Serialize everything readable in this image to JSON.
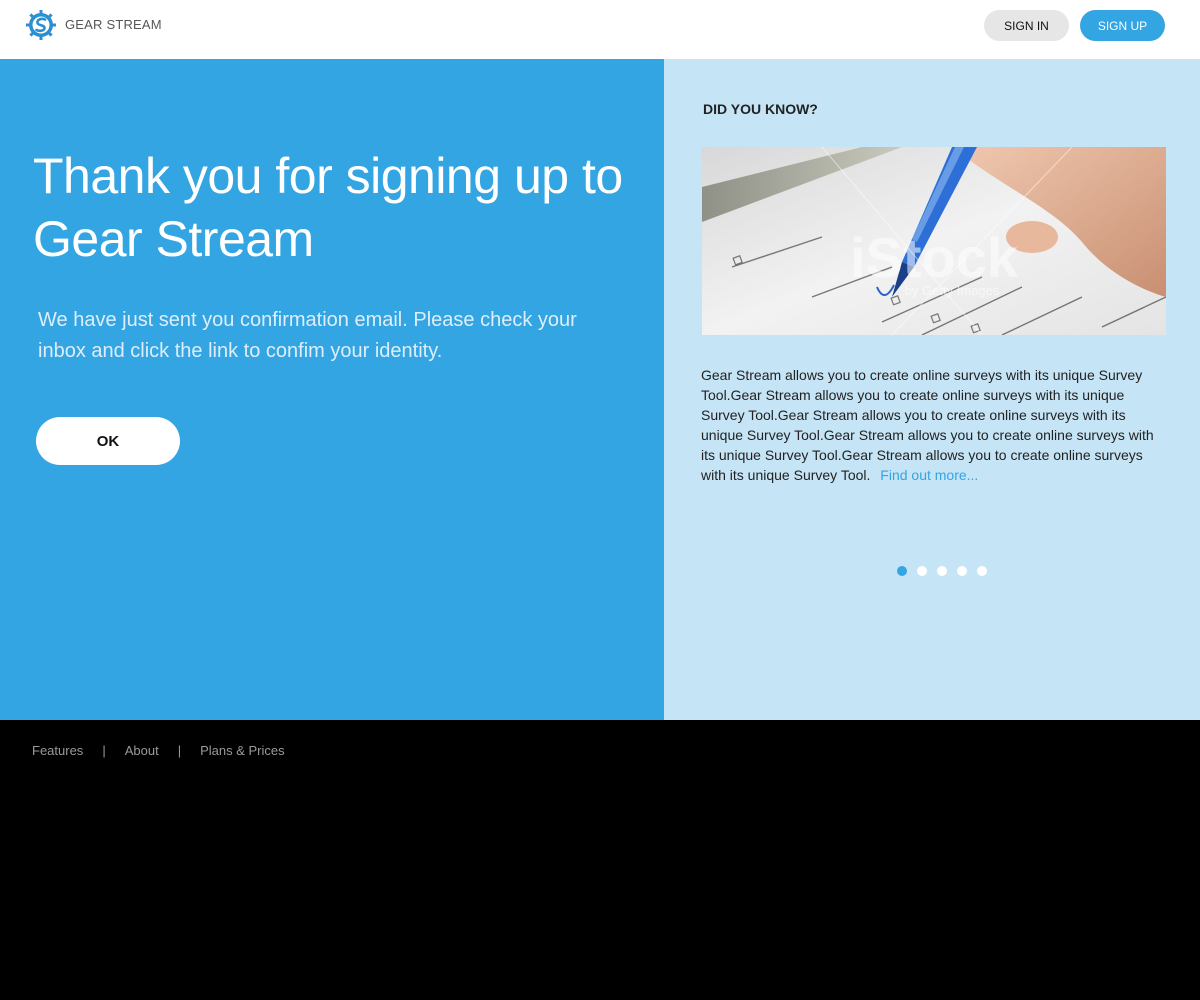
{
  "header": {
    "brand": "GEAR STREAM",
    "signin_label": "SIGN IN",
    "signup_label": "SIGN UP",
    "logo_icon": "gear-logo-icon"
  },
  "main": {
    "headline": "Thank you for signing up to Gear Stream",
    "message": "We have just sent you confirmation email. Please check your inbox and click the link to confim your identity.",
    "ok_label": "OK"
  },
  "sidebar": {
    "title": "DID YOU KNOW?",
    "image_watermark": "iStock by Getty Images",
    "body": "Gear Stream allows you to create online surveys with its unique Survey Tool.Gear Stream allows you to create online surveys with its unique Survey Tool.Gear Stream allows you to create online surveys with its unique Survey Tool.Gear Stream allows you to create online surveys with its unique Survey Tool.Gear Stream allows you to create online surveys with its unique Survey Tool.",
    "find_more": "Find out more...",
    "carousel": {
      "count": 5,
      "active_index": 0
    }
  },
  "footer": {
    "links": [
      "Features",
      "About",
      "Plans & Prices"
    ],
    "separator": "|"
  },
  "colors": {
    "accent": "#33a5e3",
    "light_panel": "#c5e4f5",
    "footer_bg": "#000000"
  }
}
